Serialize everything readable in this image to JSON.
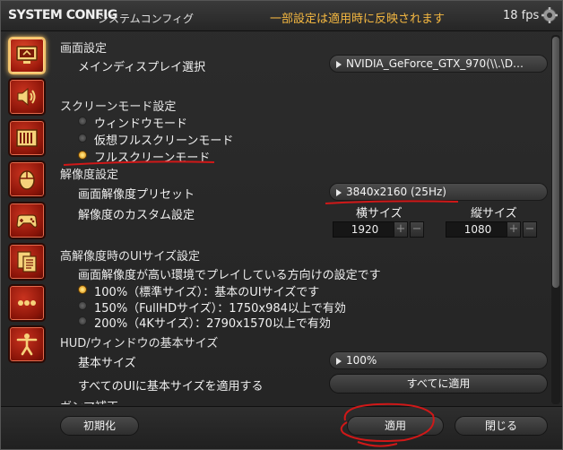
{
  "titlebar": {
    "title": "SYSTEM CONFIG",
    "subtitle": "システムコンフィグ",
    "notice": "一部設定は適用時に反映されます",
    "fps": "18 fps"
  },
  "colors": {
    "accent": "#f5b841",
    "annotation": "#d01818",
    "sidebar_red": "#9e1a0c"
  },
  "sidebar": {
    "items": [
      {
        "name": "display",
        "icon": "monitor-icon",
        "active": true
      },
      {
        "name": "sound",
        "icon": "speaker-icon"
      },
      {
        "name": "graphics",
        "icon": "graphics-icon"
      },
      {
        "name": "mouse",
        "icon": "mouse-icon"
      },
      {
        "name": "gamepad",
        "icon": "gamepad-icon"
      },
      {
        "name": "document",
        "icon": "document-icon"
      },
      {
        "name": "other",
        "icon": "more-icon"
      },
      {
        "name": "accessibility",
        "icon": "person-icon"
      }
    ]
  },
  "display": {
    "section_title": "画面設定",
    "main_display_label": "メインディスプレイ選択",
    "main_display_value": "NVIDIA_GeForce_GTX_970(\\\\.\\D…"
  },
  "screen_mode": {
    "section_title": "スクリーンモード設定",
    "options": [
      {
        "label": "ウィンドウモード",
        "selected": false
      },
      {
        "label": "仮想フルスクリーンモード",
        "selected": false
      },
      {
        "label": "フルスクリーンモード",
        "selected": true
      }
    ]
  },
  "resolution": {
    "section_title": "解像度設定",
    "preset_label": "画面解像度プリセット",
    "preset_value": "3840x2160 (25Hz)",
    "custom_label": "解像度のカスタム設定",
    "width_label": "横サイズ",
    "height_label": "縦サイズ",
    "width_value": "1920",
    "height_value": "1080",
    "plus": "+",
    "minus": "−"
  },
  "hires_ui": {
    "section_title": "高解像度時のUIサイズ設定",
    "description": "画面解像度が高い環境でプレイしている方向けの設定です",
    "options": [
      {
        "label": "100%（標準サイズ）：基本のUIサイズです",
        "selected": true
      },
      {
        "label": "150%（FullHDサイズ）：1750x984以上で有効",
        "selected": false
      },
      {
        "label": "200%（4Kサイズ）：2790x1570以上で有効",
        "selected": false
      }
    ]
  },
  "hud": {
    "section_title": "HUD/ウィンドウの基本サイズ",
    "base_size_label": "基本サイズ",
    "base_size_value": "100%",
    "apply_all_label": "すべてのUIに基本サイズを適用する",
    "apply_all_button": "すべてに適用",
    "next_section_partial": "ガンマ補正"
  },
  "footer": {
    "reset_button": "初期化",
    "apply_button": "適用",
    "close_button": "閉じる"
  }
}
